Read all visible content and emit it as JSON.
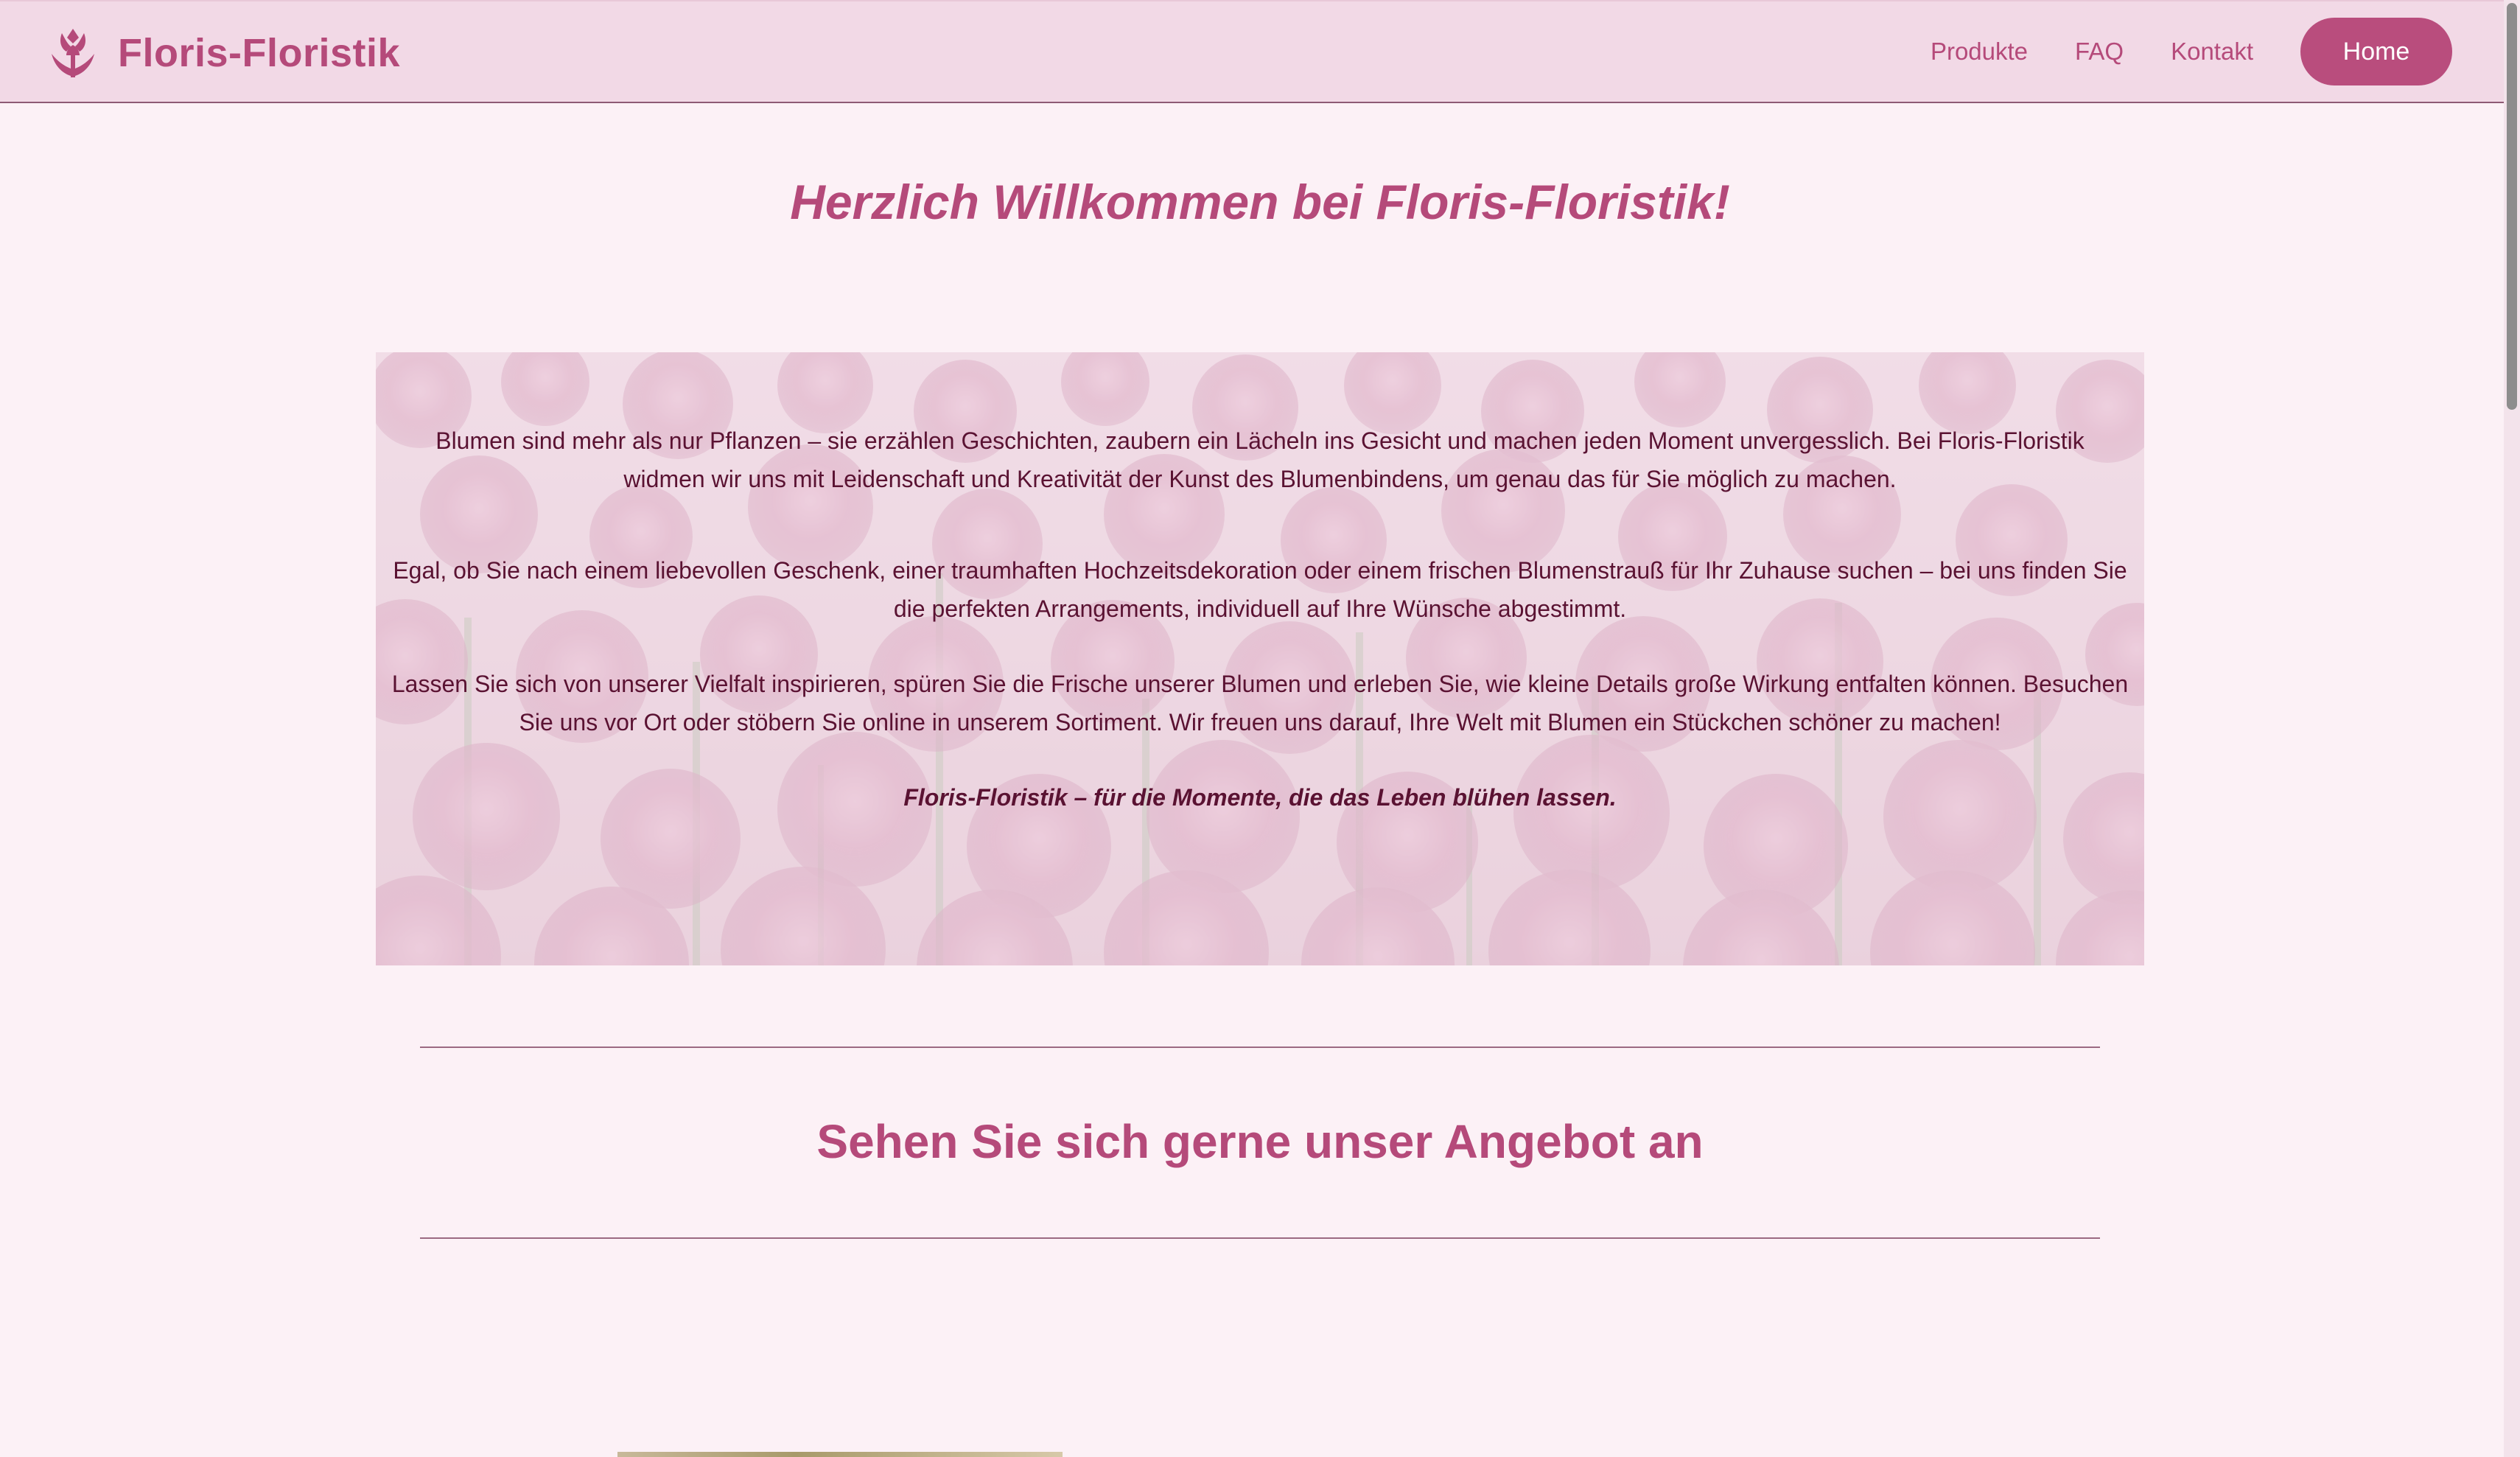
{
  "header": {
    "brand_name": "Floris-Floristik",
    "nav": {
      "products": "Produkte",
      "faq": "FAQ",
      "contact": "Kontakt",
      "home": "Home"
    }
  },
  "main": {
    "welcome_title": "Herzlich Willkommen bei Floris-Floristik!",
    "intro": {
      "paragraph_1": "Blumen sind mehr als nur Pflanzen – sie erzählen Geschichten, zaubern ein Lächeln ins Gesicht und machen jeden Moment unvergesslich. Bei Floris-Floristik widmen wir uns mit Leidenschaft und Kreativität der Kunst des Blumenbindens, um genau das für Sie möglich zu machen.",
      "paragraph_2": "Egal, ob Sie nach einem liebevollen Geschenk, einer traumhaften Hochzeitsdekoration oder einem frischen Blumenstrauß für Ihr Zuhause suchen – bei uns finden Sie die perfekten Arrangements, individuell auf Ihre Wünsche abgestimmt.",
      "paragraph_3": "Lassen Sie sich von unserer Vielfalt inspirieren, spüren Sie die Frische unserer Blumen und erleben Sie, wie kleine Details große Wirkung entfalten können. Besuchen Sie uns vor Ort oder stöbern Sie online in unserem Sortiment. Wir freuen uns darauf, Ihre Welt mit Blumen ein Stückchen schöner zu machen!",
      "tagline": "Floris-Floristik – für die Momente, die das Leben blühen lassen."
    },
    "offer_heading": "Sehen Sie sich gerne unser Angebot an"
  },
  "icons": {
    "brand": "tulip-icon"
  },
  "colors": {
    "accent": "#b54a7a",
    "header_bg": "#f2d9e6",
    "page_bg": "#fcf1f6",
    "hero_text": "#5a1232"
  }
}
